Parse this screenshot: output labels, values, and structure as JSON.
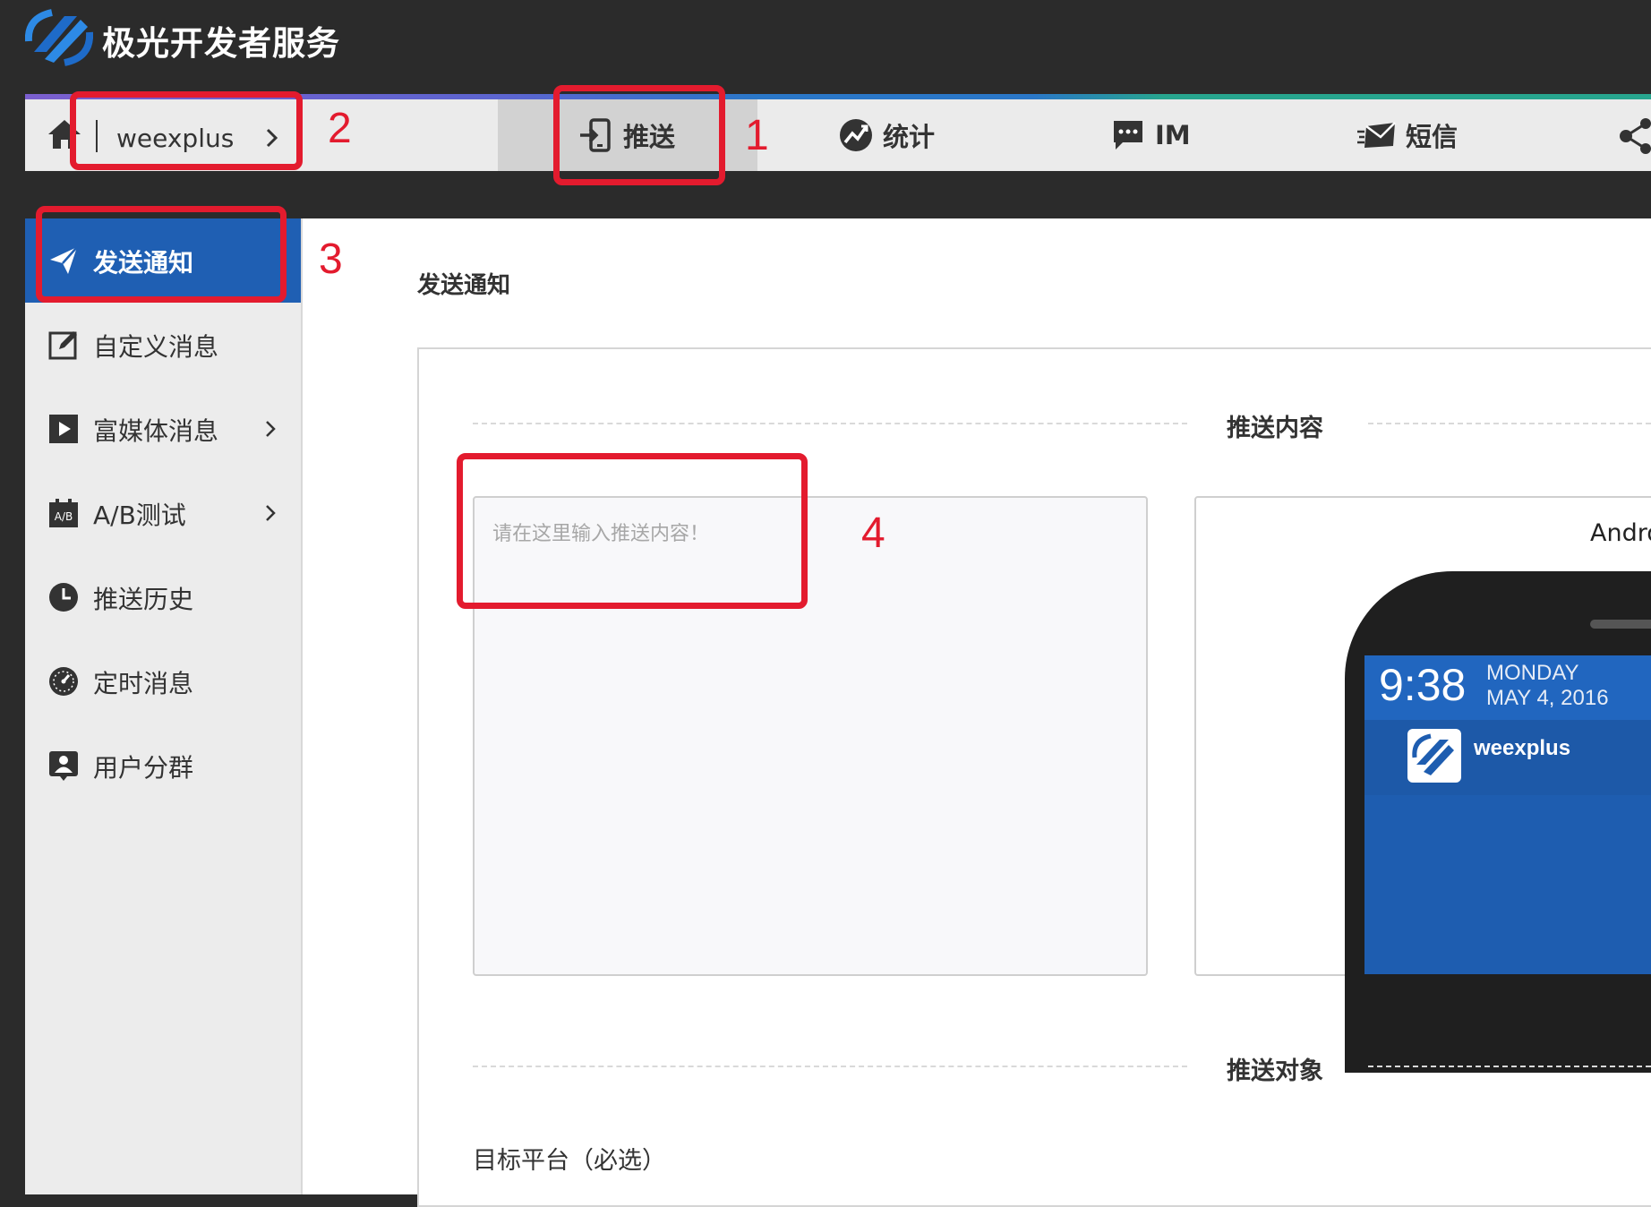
{
  "brand": {
    "title": "极光开发者服务"
  },
  "app": {
    "name": "weexplus"
  },
  "nav": {
    "tabs": [
      {
        "label": "推送",
        "icon": "push-icon",
        "active": true
      },
      {
        "label": "统计",
        "icon": "stats-icon"
      },
      {
        "label": "IM",
        "icon": "chat-icon"
      },
      {
        "label": "短信",
        "icon": "sms-icon"
      }
    ],
    "share_icon": "share-icon"
  },
  "sidebar": {
    "items": [
      {
        "label": "发送通知",
        "icon": "paper-plane-icon",
        "active": true
      },
      {
        "label": "自定义消息",
        "icon": "edit-icon"
      },
      {
        "label": "富媒体消息",
        "icon": "play-icon",
        "has_chevron": true
      },
      {
        "label": "A/B测试",
        "icon": "ab-icon",
        "icon_text": "A/B",
        "has_chevron": true
      },
      {
        "label": "推送历史",
        "icon": "clock-icon"
      },
      {
        "label": "定时消息",
        "icon": "timer-icon"
      },
      {
        "label": "用户分群",
        "icon": "user-group-icon"
      }
    ]
  },
  "main": {
    "title": "发送通知",
    "section_content": "推送内容",
    "content_placeholder": "请在这里输入推送内容！",
    "preview": {
      "label": "Andro",
      "time": "9:38",
      "day": "MONDAY",
      "date": "MAY 4, 2016",
      "app_name": "weexplus"
    },
    "section_target": "推送对象",
    "platform_label": "目标平台（必选）"
  },
  "annotations": [
    {
      "number": "1"
    },
    {
      "number": "2"
    },
    {
      "number": "3"
    },
    {
      "number": "4"
    }
  ],
  "colors": {
    "topbar": "#2b2b2b",
    "active_sidebar": "#1f5fb3",
    "callout": "#e31b2e",
    "phone_screen": "#1e5db0"
  }
}
